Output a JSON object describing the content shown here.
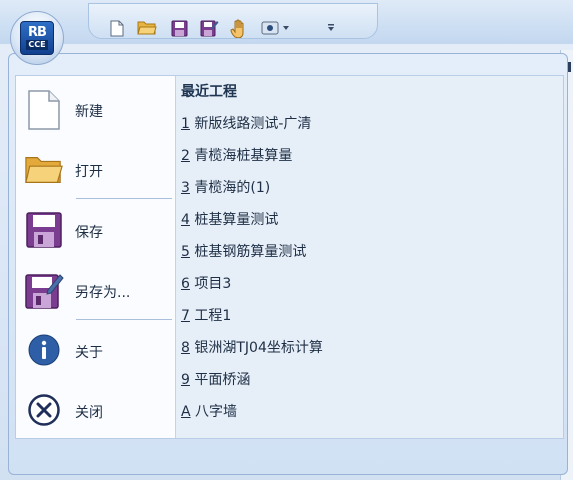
{
  "app": {
    "logo_top": "RB",
    "logo_bottom": "CCE"
  },
  "quick_access": [
    {
      "icon": "new-file-icon"
    },
    {
      "icon": "open-folder-icon"
    },
    {
      "icon": "save-icon"
    },
    {
      "icon": "save-as-icon"
    },
    {
      "icon": "hand-icon"
    },
    {
      "icon": "view-icon"
    },
    {
      "icon": "customize-dropdown-icon"
    }
  ],
  "menu": {
    "commands": [
      {
        "label": "新建",
        "icon": "new-file-icon"
      },
      {
        "label": "打开",
        "icon": "open-folder-icon"
      },
      {
        "label": "保存",
        "icon": "save-icon"
      },
      {
        "label": "另存为...",
        "icon": "save-as-icon"
      },
      {
        "label": "关于",
        "icon": "info-icon"
      },
      {
        "label": "关闭",
        "icon": "close-icon"
      }
    ],
    "recent": {
      "title": "最近工程",
      "items": [
        {
          "num": "1",
          "name": "新版线路测试-广清"
        },
        {
          "num": "2",
          "name": "青榄海桩基算量"
        },
        {
          "num": "3",
          "name": "青榄海的(1)"
        },
        {
          "num": "4",
          "name": "桩基算量测试"
        },
        {
          "num": "5",
          "name": "桩基钢筋算量测试"
        },
        {
          "num": "6",
          "name": "项目3"
        },
        {
          "num": "7",
          "name": "工程1"
        },
        {
          "num": "8",
          "name": "银洲湖TJ04坐标计算"
        },
        {
          "num": "9",
          "name": "平面桥涵"
        },
        {
          "num": "A",
          "name": "八字墙"
        }
      ]
    }
  }
}
